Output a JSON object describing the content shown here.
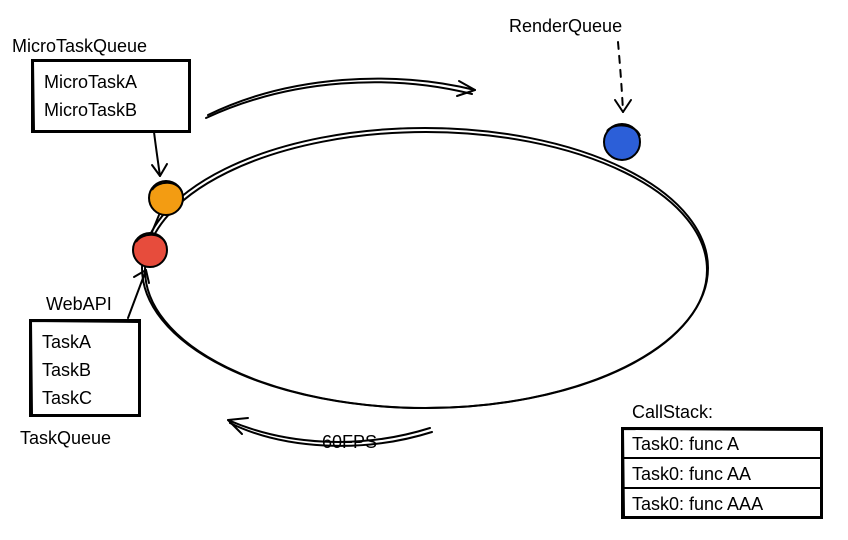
{
  "labels": {
    "microTaskQueue": "MicroTaskQueue",
    "renderQueue": "RenderQueue",
    "webApi": "WebAPI",
    "taskQueue": "TaskQueue",
    "callStack": "CallStack:",
    "fps": "60FPS"
  },
  "microTasks": [
    "MicroTaskA",
    "MicroTaskB"
  ],
  "tasks": [
    "TaskA",
    "TaskB",
    "TaskC"
  ],
  "callStackEntries": [
    "Task0: func A",
    "Task0: func AA",
    "Task0: func AAA"
  ],
  "colors": {
    "redNode": "#e74c3c",
    "orangeNode": "#f39c12",
    "blueNode": "#2c5fd8"
  }
}
